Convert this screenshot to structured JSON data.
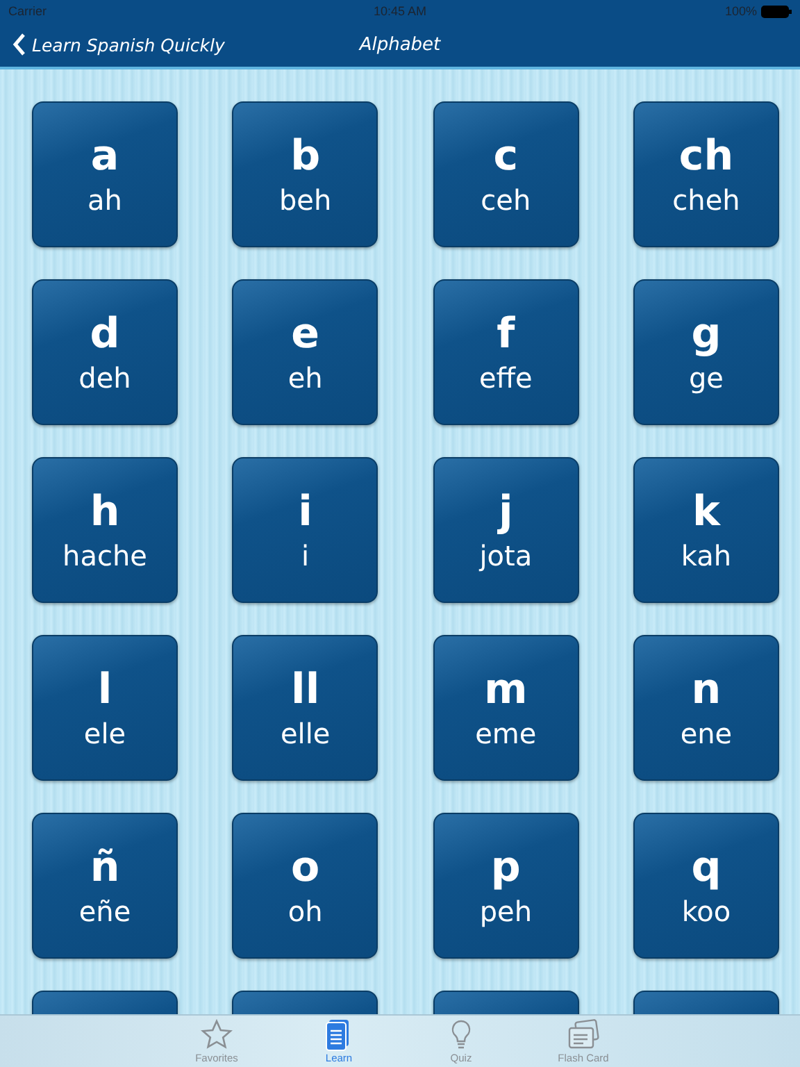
{
  "status_bar": {
    "carrier": "Carrier",
    "time": "10:45 AM",
    "battery": "100%"
  },
  "nav_bar": {
    "back": "Learn Spanish Quickly",
    "title": "Alphabet"
  },
  "tiles": [
    {
      "kind": "letter",
      "letter": "a",
      "name": "ah"
    },
    {
      "kind": "letter",
      "letter": "b",
      "name": "beh"
    },
    {
      "kind": "letter",
      "letter": "c",
      "name": "ceh"
    },
    {
      "kind": "letter",
      "letter": "ch",
      "name": "cheh"
    },
    {
      "kind": "letter",
      "letter": "d",
      "name": "deh"
    },
    {
      "kind": "letter",
      "letter": "e",
      "name": "eh"
    },
    {
      "kind": "letter",
      "letter": "f",
      "name": "effe"
    },
    {
      "kind": "letter",
      "letter": "g",
      "name": "ge"
    },
    {
      "kind": "letter",
      "letter": "h",
      "name": "hache"
    },
    {
      "kind": "letter",
      "letter": "i",
      "name": "i"
    },
    {
      "kind": "letter",
      "letter": "j",
      "name": "jota"
    },
    {
      "kind": "letter",
      "letter": "k",
      "name": "kah"
    },
    {
      "kind": "letter",
      "letter": "l",
      "name": "ele"
    },
    {
      "kind": "letter",
      "letter": "ll",
      "name": "elle"
    },
    {
      "kind": "letter",
      "letter": "m",
      "name": "eme"
    },
    {
      "kind": "letter",
      "letter": "n",
      "name": "ene"
    },
    {
      "kind": "letter",
      "letter": "ñ",
      "name": "eñe"
    },
    {
      "kind": "letter",
      "letter": "o",
      "name": "oh"
    },
    {
      "kind": "letter",
      "letter": "p",
      "name": "peh"
    },
    {
      "kind": "letter",
      "letter": "q",
      "name": "koo"
    },
    {
      "kind": "partial"
    },
    {
      "kind": "partial"
    },
    {
      "kind": "partial"
    },
    {
      "kind": "partial"
    }
  ],
  "tab_bar": [
    {
      "kind": "star",
      "label": "Favorites",
      "selected": false
    },
    {
      "kind": "doc",
      "label": "Learn",
      "selected": true
    },
    {
      "kind": "bulb",
      "label": "Quiz",
      "selected": false
    },
    {
      "kind": "card",
      "label": "Flash Card",
      "selected": false
    }
  ]
}
